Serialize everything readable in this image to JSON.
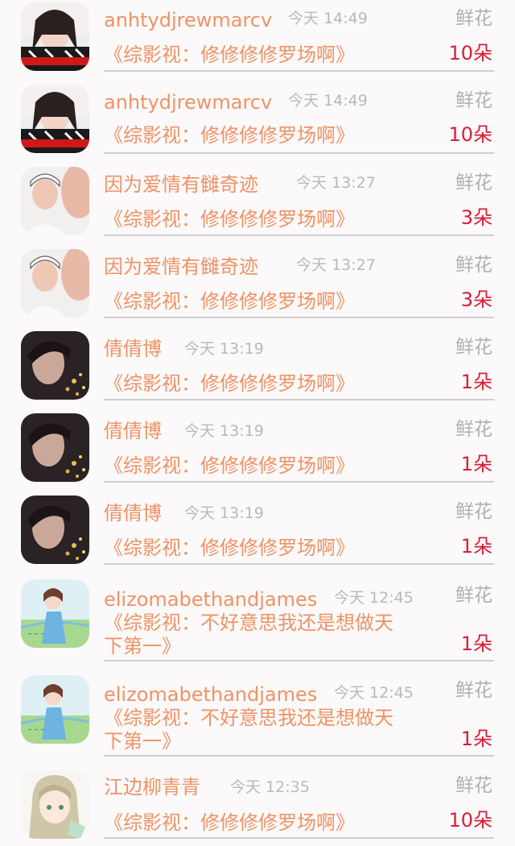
{
  "gift_label": "鲜花",
  "items": [
    {
      "user": "anhtydjrewmarcv",
      "time": "今天 14:49",
      "title": "《综影视：修修修修罗场啊》",
      "count": "10朵",
      "avatar": "avatar-girl-red"
    },
    {
      "user": "anhtydjrewmarcv",
      "time": "今天 14:49",
      "title": "《综影视：修修修修罗场啊》",
      "count": "10朵",
      "avatar": "avatar-girl-red"
    },
    {
      "user": "因为爱情有雠奇迹",
      "time": "今天 13:27",
      "title": "《综影视：修修修修罗场啊》",
      "count": "3朵",
      "avatar": "avatar-boy-cap"
    },
    {
      "user": "因为爱情有雠奇迹",
      "time": "今天 13:27",
      "title": "《综影视：修修修修罗场啊》",
      "count": "3朵",
      "avatar": "avatar-boy-cap"
    },
    {
      "user": "倩倩博",
      "time": "今天 13:19",
      "title": "《综影视：修修修修罗场啊》",
      "count": "1朵",
      "avatar": "avatar-man-dark"
    },
    {
      "user": "倩倩博",
      "time": "今天 13:19",
      "title": "《综影视：修修修修罗场啊》",
      "count": "1朵",
      "avatar": "avatar-man-dark"
    },
    {
      "user": "倩倩博",
      "time": "今天 13:19",
      "title": "《综影视：修修修修罗场啊》",
      "count": "1朵",
      "avatar": "avatar-man-dark"
    },
    {
      "user": "elizomabethandjames",
      "time": "今天 12:45",
      "title": "《综影视：不好意思我还是想做天",
      "title2": "下第一》",
      "count": "1朵",
      "avatar": "avatar-girl-green"
    },
    {
      "user": "elizomabethandjames",
      "time": "今天 12:45",
      "title": "《综影视：不好意思我还是想做天",
      "title2": "下第一》",
      "count": "1朵",
      "avatar": "avatar-girl-green"
    },
    {
      "user": "江边柳青青",
      "time": "今天 12:35",
      "title": "《综影视：修修修修罗场啊》",
      "count": "10朵",
      "avatar": "avatar-anime-girl"
    }
  ]
}
